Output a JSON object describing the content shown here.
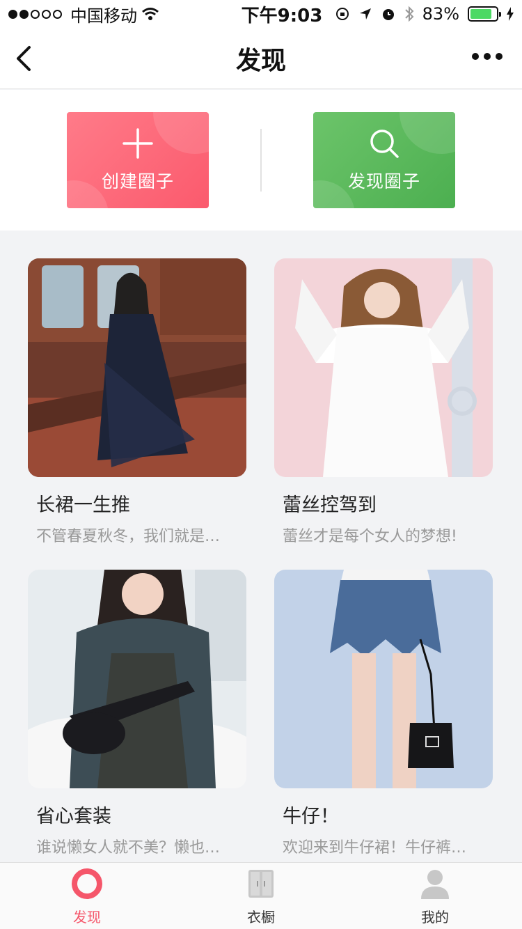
{
  "status_bar": {
    "carrier": "中国移动",
    "time": "下午9:03",
    "battery": "83%",
    "battery_level": 0.83
  },
  "nav": {
    "title": "发现"
  },
  "actions": {
    "create_label": "创建圈子",
    "discover_label": "发现圈子"
  },
  "cards": [
    {
      "title": "长裙一生推",
      "desc": "不管春夏秋冬，我们就是…"
    },
    {
      "title": "蕾丝控驾到",
      "desc": "蕾丝才是每个女人的梦想!"
    },
    {
      "title": "省心套装",
      "desc": "谁说懒女人就不美？懒也…"
    },
    {
      "title": "牛仔！",
      "desc": "欢迎来到牛仔裙！牛仔裤…"
    }
  ],
  "tabs": [
    {
      "label": "发现",
      "active": true
    },
    {
      "label": "衣橱",
      "active": false
    },
    {
      "label": "我的",
      "active": false
    }
  ],
  "colors": {
    "accent": "#f5566a",
    "create_button": "#fb6b7b",
    "discover_button": "#5cba5d"
  }
}
